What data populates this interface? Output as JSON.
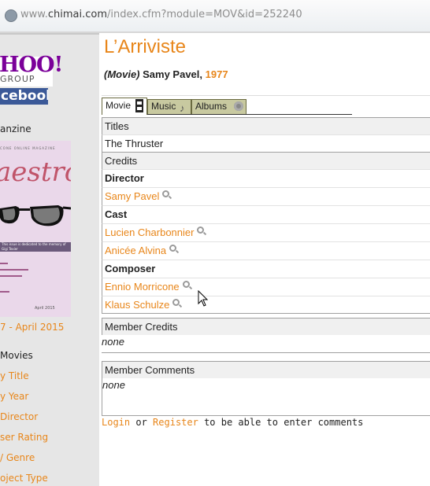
{
  "browser": {
    "url_prefix": "www.",
    "url_host": "chimai.com",
    "url_path": "/index.cfm?module=MOV&id=252240"
  },
  "sidebar": {
    "yahoo_line1": "HOO!",
    "yahoo_line2": "GROUP",
    "facebook": "cebook",
    "magazine_label": "anzine",
    "magazine_cover": {
      "header": "CONE  ONLINE MAGAZINE",
      "script": "aestro",
      "banner": "This issue is dedicated to the memory of Gigi Texier",
      "date": "April 2015"
    },
    "magazine_date": "7 - April 2015",
    "movies_heading": "Movies",
    "nav": [
      {
        "label": "y Title"
      },
      {
        "label": "y Year"
      },
      {
        "label": " Director"
      },
      {
        "label": "ser Rating"
      },
      {
        "label": "/ Genre"
      },
      {
        "label": "oject Type"
      }
    ]
  },
  "main": {
    "title": "L’Arriviste",
    "type": "(Movie)",
    "director": "Samy Pavel,",
    "year": "1977",
    "tabs": [
      {
        "label": "Movie",
        "icon": "film-icon",
        "active": true
      },
      {
        "label": "Music",
        "icon": "music-note-icon",
        "active": false
      },
      {
        "label": "Albums",
        "icon": "disc-icon",
        "active": false
      }
    ],
    "titles_header": "Titles",
    "titles": [
      "The Thruster"
    ],
    "credits_header": "Credits",
    "credits": [
      {
        "role": "Director",
        "people": [
          "Samy Pavel"
        ]
      },
      {
        "role": "Cast",
        "people": [
          "Lucien Charbonnier",
          "Anicée Alvina"
        ]
      },
      {
        "role": "Composer",
        "people": [
          "Ennio Morricone",
          "Klaus Schulze"
        ]
      }
    ],
    "member_credits_header": "Member Credits",
    "member_credits_value": "none",
    "member_comments_header": "Member Comments",
    "member_comments_value": "none",
    "footer": {
      "login": "Login",
      "or": "or",
      "register": "Register",
      "suffix": "to be able to enter comments"
    }
  },
  "colors": {
    "accent": "#e8861a",
    "tab_inactive": "#c8c9a0",
    "facebook": "#3b5998",
    "yahoo": "#7b0099"
  }
}
